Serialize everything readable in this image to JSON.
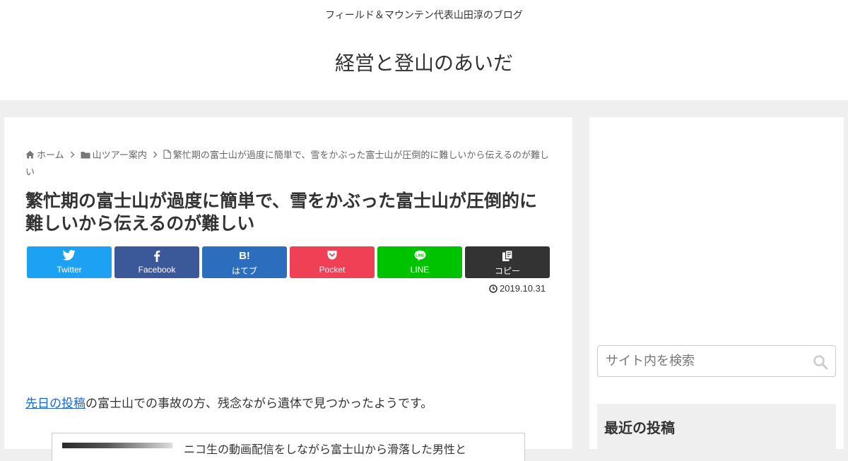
{
  "header": {
    "tagline": "フィールド＆マウンテン代表山田淳のブログ",
    "site_name": "経営と登山のあいだ"
  },
  "breadcrumb": {
    "home": "ホーム",
    "category": "山ツアー案内",
    "current": "繁忙期の富士山が過度に簡単で、雪をかぶった富士山が圧倒的に難しいから伝えるのが難しい"
  },
  "post": {
    "title": "繁忙期の富士山が過度に簡単で、雪をかぶった富士山が圧倒的に難しいから伝えるのが難しい",
    "date": "2019.10.31",
    "body_link": "先日の投稿",
    "body_rest": "の富士山での事故の方、残念ながら遺体で見つかったようです。",
    "embed_title": "ニコ生の動画配信をしながら富士山から滑落した男性と"
  },
  "share": {
    "twitter": "Twitter",
    "facebook": "Facebook",
    "hatena": "はてブ",
    "hatena_icon": "B!",
    "pocket": "Pocket",
    "line": "LINE",
    "copy": "コピー",
    "colors": {
      "twitter": "#1da1f2",
      "facebook": "#3b5998",
      "hatena": "#2c6ebd",
      "pocket": "#ef4056",
      "line": "#00c300",
      "copy": "#333333"
    }
  },
  "sidebar": {
    "search_placeholder": "サイト内を検索",
    "recent_title": "最近の投稿"
  },
  "icons": {
    "home": "home-icon",
    "folder": "folder-icon",
    "page": "file-icon",
    "clock": "clock-icon",
    "search": "search-icon"
  }
}
